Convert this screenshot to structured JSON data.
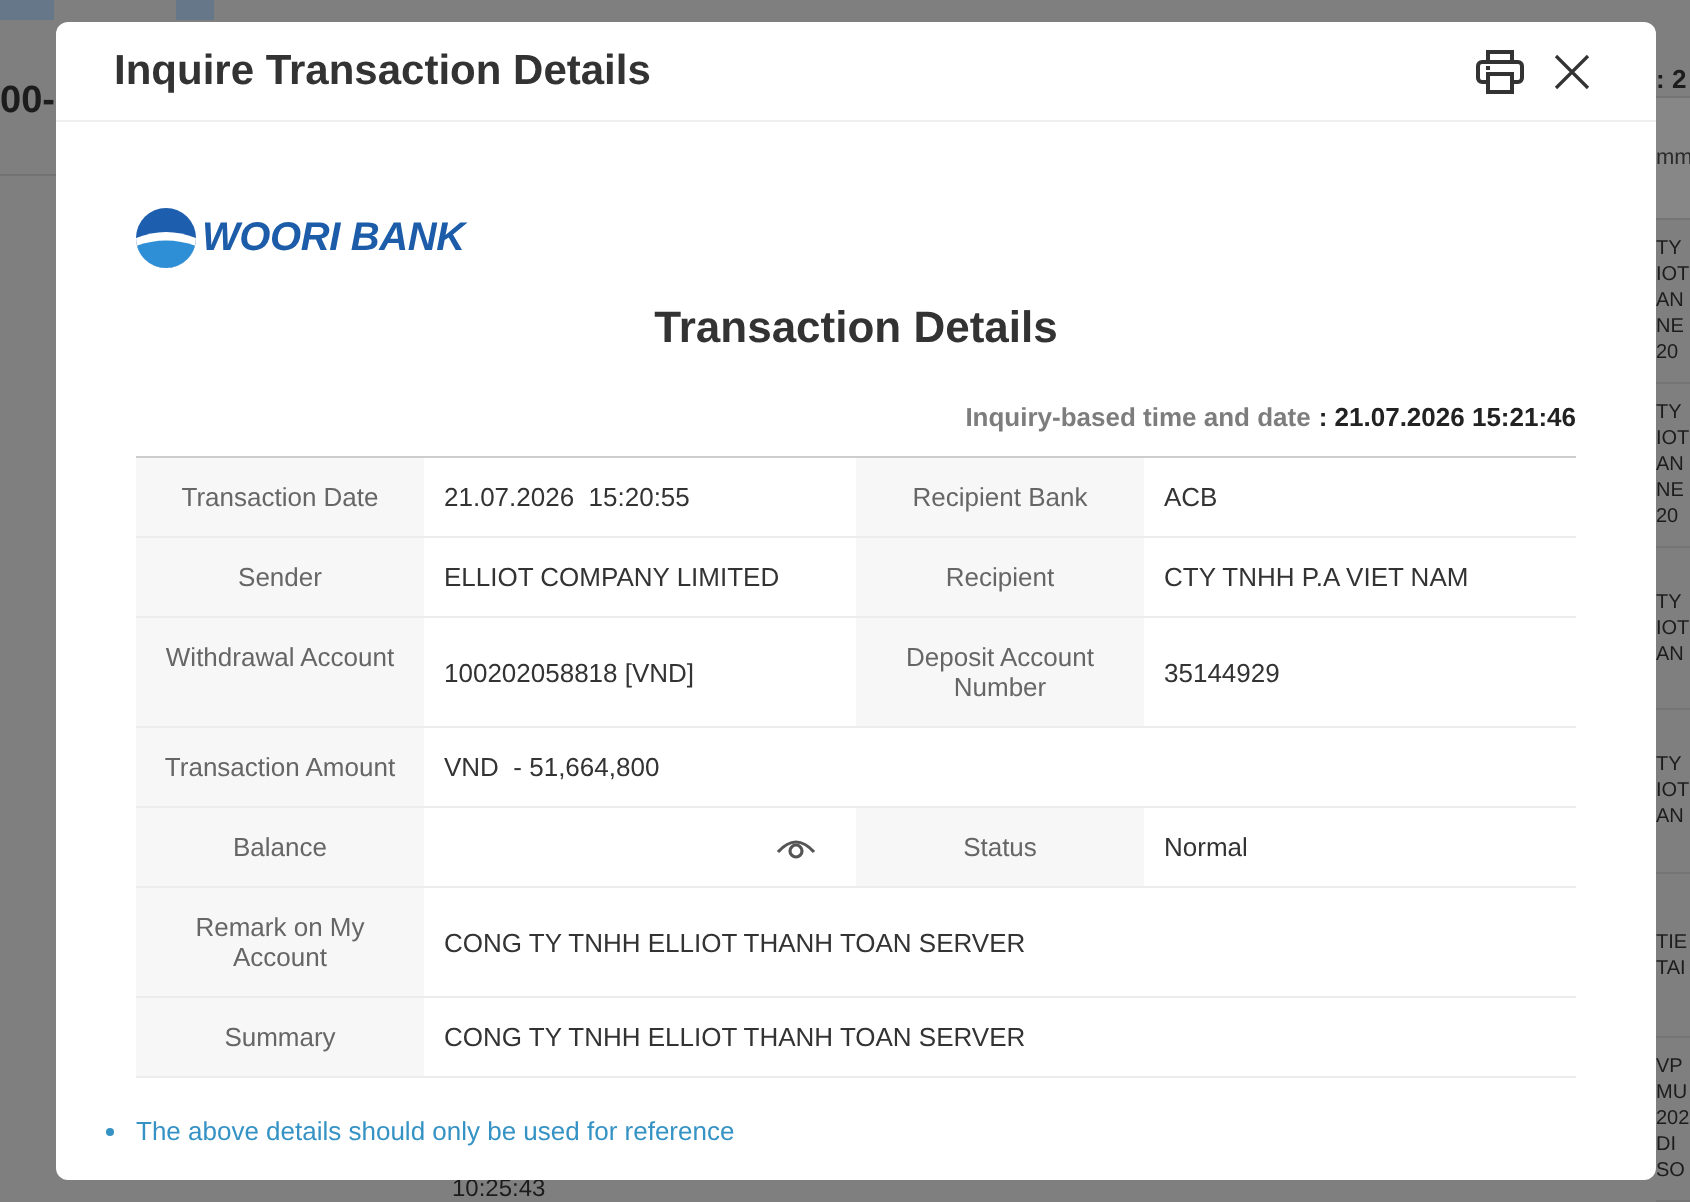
{
  "background_page": {
    "heading": "00-",
    "date": ": 2",
    "column_header": "mm",
    "cells": [
      [
        "TY",
        "IOT",
        "AN",
        "NE",
        "20"
      ],
      [
        "TY",
        "IOT",
        "AN",
        "NE",
        "20"
      ],
      [
        "TY",
        "IOT",
        "AN"
      ],
      [
        "TY",
        "IOT",
        "AN"
      ],
      [
        "TIE",
        "TAI"
      ],
      [
        "VP",
        "MU",
        "202",
        "DI",
        "SO"
      ]
    ],
    "time": "10:25:43"
  },
  "dialog": {
    "title": "Inquire Transaction Details",
    "actions": [
      {
        "kind": "print"
      },
      {
        "kind": "close"
      }
    ]
  },
  "receipt": {
    "bank_name": "WOORI BANK",
    "heading": "Transaction Details",
    "inquiry": {
      "label": "Inquiry-based time and date",
      "value": ": 21.07.2026 15:21:46"
    },
    "rows": [
      {
        "cells": [
          {
            "label": "Transaction Date",
            "kind": "text",
            "value": "21.07.2026  15:20:55"
          },
          {
            "label": "Recipient Bank",
            "kind": "text",
            "value": "ACB"
          }
        ]
      },
      {
        "cells": [
          {
            "label": "Sender",
            "kind": "text",
            "value": "ELLIOT COMPANY LIMITED"
          },
          {
            "label": "Recipient",
            "kind": "text",
            "value": "CTY TNHH P.A VIET NAM"
          }
        ]
      },
      {
        "cells": [
          {
            "label": "Withdrawal Account",
            "kind": "text",
            "value": "100202058818 [VND]"
          },
          {
            "label": "Deposit Account Number",
            "kind": "text",
            "value": "35144929"
          }
        ]
      },
      {
        "cells": [
          {
            "label": "Transaction Amount",
            "kind": "text",
            "value": "VND  - 51,664,800"
          }
        ]
      },
      {
        "cells": [
          {
            "label": "Balance",
            "kind": "masked"
          },
          {
            "label": "Status",
            "kind": "text",
            "value": "Normal"
          }
        ]
      },
      {
        "cells": [
          {
            "label": "Remark on My Account",
            "kind": "text",
            "value": "CONG TY TNHH ELLIOT THANH TOAN SERVER"
          }
        ]
      },
      {
        "cells": [
          {
            "label": "Summary",
            "kind": "text",
            "value": "CONG TY TNHH ELLIOT THANH TOAN SERVER"
          }
        ]
      }
    ]
  },
  "notes": [
    "The above details should only be used for reference"
  ]
}
